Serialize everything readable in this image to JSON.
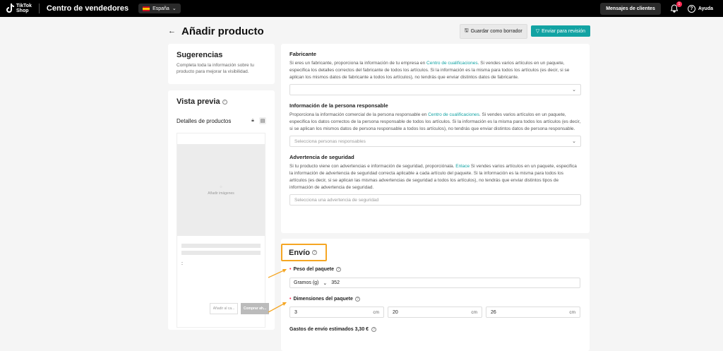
{
  "topbar": {
    "logo_line1": "TikTok",
    "logo_line2": "Shop",
    "app_title": "Centro de vendedores",
    "region": "España",
    "messages_button": "Mensajes de clientes",
    "notification_count": "1",
    "help_label": "Ayuda"
  },
  "header": {
    "title": "Añadir producto",
    "save_draft": "Guardar como borrador",
    "submit": "Enviar para revisión"
  },
  "suggestions": {
    "title": "Sugerencias",
    "text": "Completa toda la información sobre tu producto para mejorar la visibilidad."
  },
  "preview": {
    "title": "Vista previa",
    "details_label": "Detalles de productos",
    "add_images": "Añadir imágenes",
    "colon": ":",
    "add_cart": "Añadir al ca...",
    "buy_now": "Comprar ah..."
  },
  "manufacturer": {
    "title": "Fabricante",
    "text_before_link": "Si eres un fabricante, proporciona la información de tu empresa en ",
    "link": "Centro de cualificaciones",
    "text_after_link": ". Si vendes varios artículos en un paquete, especifica los detalles correctos del fabricante de todos los artículos. Si la información es la misma para todos los artículos (es decir, si se aplican los mismos datos de fabricante a todos los artículos), no tendrás que enviar distintos datos de fabricante.",
    "select_value": ""
  },
  "responsible": {
    "title": "Información de la persona responsable",
    "text_before_link": "Proporciona la información comercial de la persona responsable en ",
    "link": "Centro de cualificaciones",
    "text_after_link": ". Si vendes varios artículos en un paquete, especifica los datos correctos de la persona responsable de todos los artículos. Si la información es la misma para todos los artículos (es decir, si se aplican los mismos datos de persona responsable a todos los artículos), no tendrás que enviar distintos datos de persona responsable.",
    "placeholder": "Selecciona personas responsables"
  },
  "safety": {
    "title": "Advertencia de seguridad",
    "text_before_link": "Si tu producto viene con advertencias e información de seguridad, proporciónala. ",
    "link": "Enlace",
    "text_after_link": " Si vendes varios artículos en un paquete, especifica la información de advertencia de seguridad correcta aplicable a cada artículo del paquete. Si la información es la misma para todos los artículos (es decir, si se aplican las mismas advertencias de seguridad a todos los artículos), no tendrás que enviar distintos tipos de información de advertencia de seguridad.",
    "placeholder": "Selecciona una advertencia de seguridad"
  },
  "shipping": {
    "title": "Envío",
    "weight_label": "Peso del paquete",
    "weight_unit": "Gramos (g)",
    "weight_value": "352",
    "dimensions_label": "Dimensiones del paquete",
    "dimensions": [
      {
        "value": "3",
        "unit": "cm"
      },
      {
        "value": "20",
        "unit": "cm"
      },
      {
        "value": "26",
        "unit": "cm"
      }
    ],
    "cost_label": "Gastos de envío estimados 3,30 €"
  },
  "colors": {
    "accent": "#12a3a3",
    "highlight": "#f5a623",
    "required": "#fe2c55"
  }
}
